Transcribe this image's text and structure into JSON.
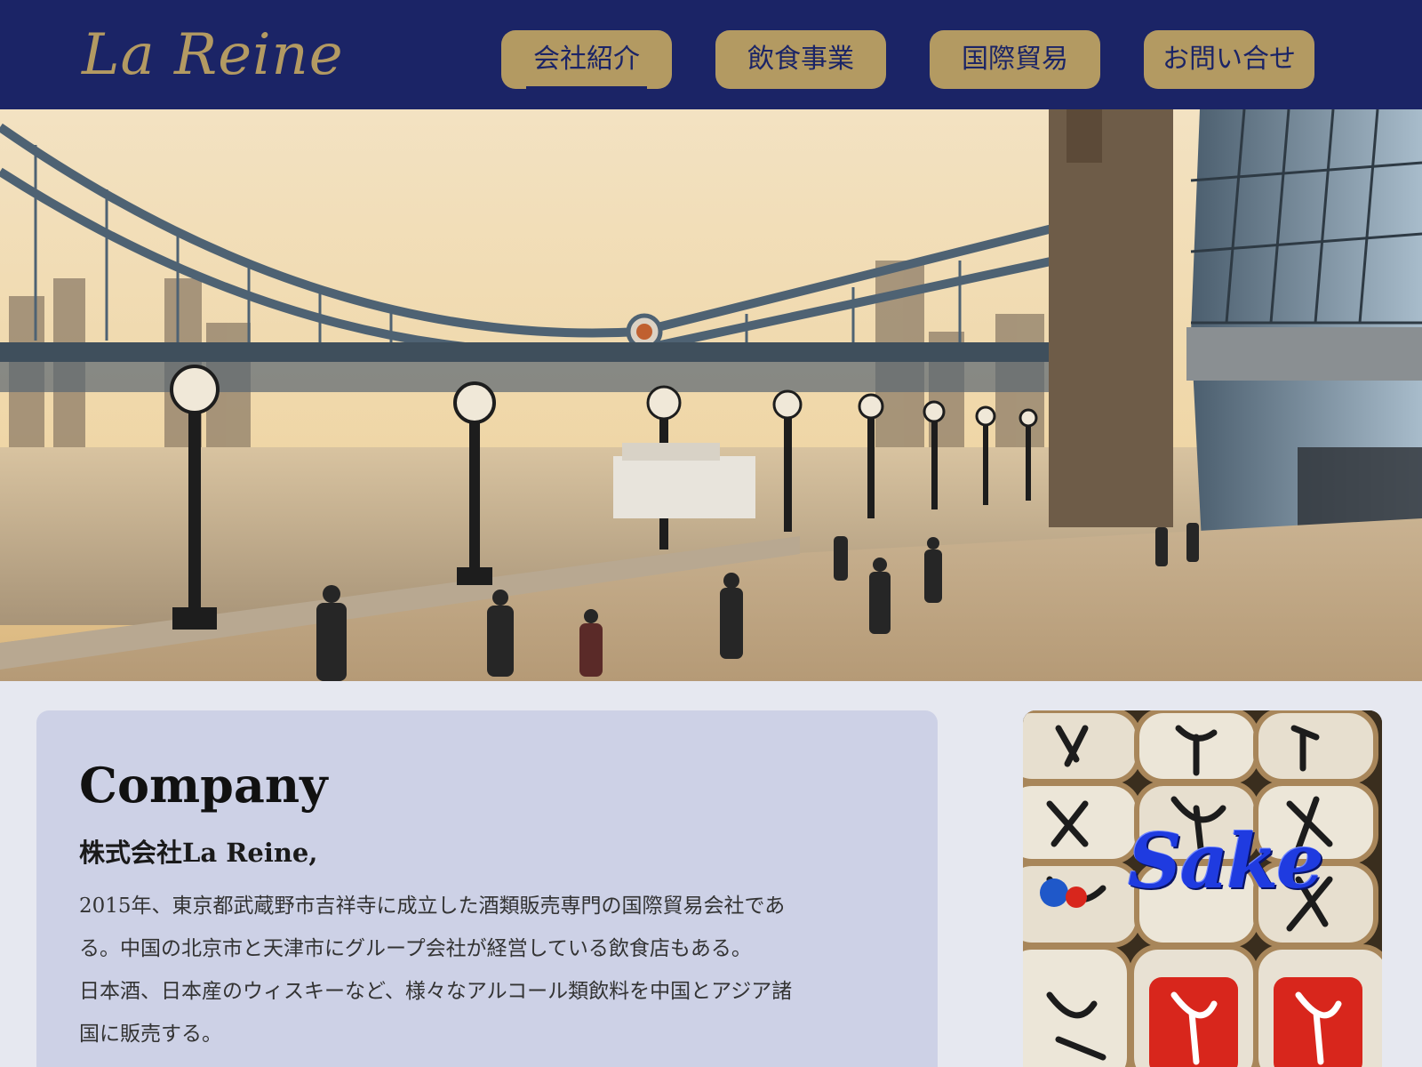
{
  "header": {
    "logo": "La Reine",
    "nav": [
      {
        "label": "会社紹介",
        "active": true
      },
      {
        "label": "飲食事業",
        "active": false
      },
      {
        "label": "国際貿易",
        "active": false
      },
      {
        "label": "お問い合せ",
        "active": false
      }
    ]
  },
  "hero": {
    "image": "photo of Tower Bridge and Thames riverside walkway at sunset"
  },
  "company": {
    "heading": "Company",
    "name": "株式会社La Reine,",
    "description_lines": [
      "2015年、東京都武蔵野市吉祥寺に成立した酒類販売専門の国際貿易会社であ",
      "る。中国の北京市と天津市にグループ会社が経営している飲食店もある。",
      "日本酒、日本産のウィスキーなど、様々なアルコール類飲料を中国とアジア諸",
      "国に販売する。"
    ]
  },
  "sake_image": {
    "overlay_text": "Sake",
    "image": "photo of stacked Japanese sake barrels"
  },
  "colors": {
    "header_bg": "#1b2466",
    "gold": "#b39a62",
    "page_bg": "#e6e8f0",
    "card_bg": "#cdd1e6",
    "sake_text": "#1f3be0"
  }
}
